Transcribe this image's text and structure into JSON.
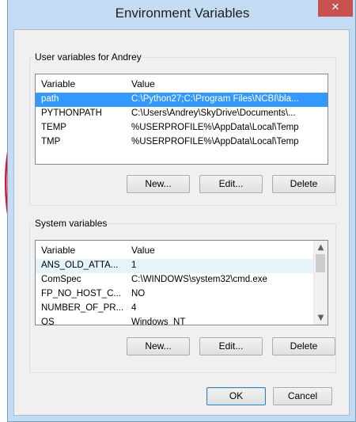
{
  "window": {
    "title": "Environment Variables",
    "close_glyph": "✕"
  },
  "user_group": {
    "label": "User variables for Andrey",
    "headers": [
      "Variable",
      "Value"
    ],
    "rows": [
      {
        "variable": "path",
        "value": "C:\\Python27;C:\\Program Files\\NCBI\\bla...",
        "selected": true
      },
      {
        "variable": "PYTHONPATH",
        "value": "C:\\Users\\Andrey\\SkyDrive\\Documents\\..."
      },
      {
        "variable": "TEMP",
        "value": "%USERPROFILE%\\AppData\\Local\\Temp"
      },
      {
        "variable": "TMP",
        "value": "%USERPROFILE%\\AppData\\Local\\Temp"
      }
    ],
    "buttons": {
      "new": "New...",
      "edit": "Edit...",
      "delete": "Delete"
    }
  },
  "system_group": {
    "label": "System variables",
    "headers": [
      "Variable",
      "Value"
    ],
    "rows": [
      {
        "variable": "ANS_OLD_ATTA...",
        "value": "1"
      },
      {
        "variable": "ComSpec",
        "value": "C:\\WINDOWS\\system32\\cmd.exe"
      },
      {
        "variable": "FP_NO_HOST_C...",
        "value": "NO"
      },
      {
        "variable": "NUMBER_OF_PR...",
        "value": "4"
      },
      {
        "variable": "OS",
        "value": "Windows_NT"
      }
    ],
    "buttons": {
      "new": "New...",
      "edit": "Edit...",
      "delete": "Delete"
    }
  },
  "dialog_buttons": {
    "ok": "OK",
    "cancel": "Cancel"
  },
  "colors": {
    "selection": "#3399ff",
    "annotation_arrow": "#e0102f",
    "close_button": "#c75050"
  },
  "icons": {
    "scroll_up": "▲",
    "scroll_down": "▼"
  }
}
